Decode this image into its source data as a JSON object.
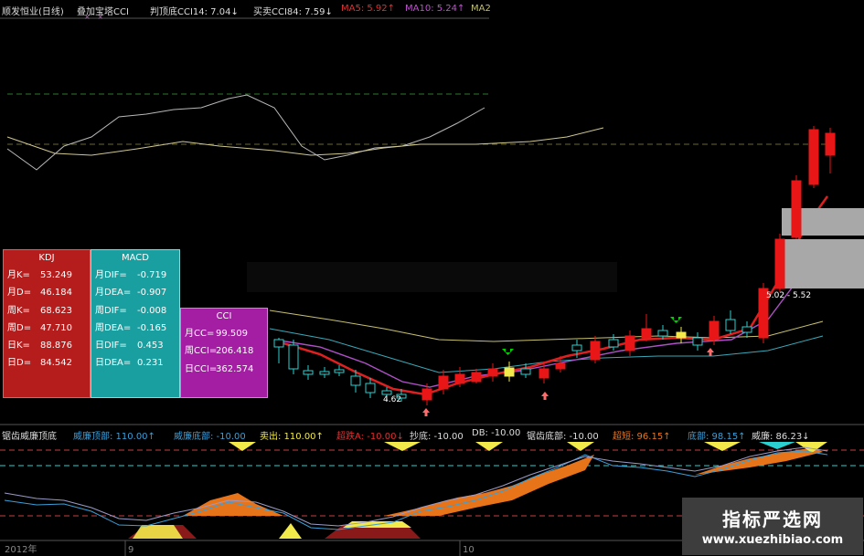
{
  "header": {
    "stock": "顺发恒业(日线)",
    "overlay": "叠加宝塔CCI",
    "ind1": "判顶底CCI14: 7.04↓",
    "ind2": "买卖CCI84: 7.59↓",
    "ma5": "MA5: 5.92↑",
    "ma10": "MA10: 5.24↑",
    "ma20": "MA2"
  },
  "price_labels": {
    "high": "5.02 - 5.52",
    "low": "4.62"
  },
  "kdj": {
    "title": "KDJ",
    "rows": [
      {
        "k": "月K=",
        "v": "53.249"
      },
      {
        "k": "月D=",
        "v": "46.184"
      },
      {
        "k": "周K=",
        "v": "68.623"
      },
      {
        "k": "周D=",
        "v": "47.710"
      },
      {
        "k": "日K=",
        "v": "88.876"
      },
      {
        "k": "日D=",
        "v": "84.542"
      }
    ]
  },
  "macd": {
    "title": "MACD",
    "rows": [
      {
        "k": "月DIF=",
        "v": "-0.719"
      },
      {
        "k": "月DEA=",
        "v": "-0.907"
      },
      {
        "k": "周DIF=",
        "v": "-0.008"
      },
      {
        "k": "周DEA=",
        "v": "-0.165"
      },
      {
        "k": "日DIF=",
        "v": "0.453"
      },
      {
        "k": "日DEA=",
        "v": "0.231"
      }
    ]
  },
  "cci": {
    "title": "CCI",
    "rows": [
      {
        "k": "月CC=",
        "v": "99.509"
      },
      {
        "k": "周CCI=",
        "v": "206.418"
      },
      {
        "k": "日CCI=",
        "v": "362.574"
      }
    ]
  },
  "sub": {
    "title": "锯齿威廉顶底",
    "a": "威廉顶部: 110.00↑",
    "b": "威廉底部: -10.00",
    "c": "卖出: 110.00↑",
    "d": "超跌A: -10.00↓",
    "e": "抄底: -10.00",
    "f": "DB: -10.00",
    "g": "锯齿底部: -10.00",
    "h": "超短: 96.15↑",
    "i": "底部: 98.15↑",
    "j": "威廉: 86.23↓"
  },
  "axis": {
    "year": "2012年",
    "m1": "9",
    "m2": "10"
  },
  "watermark": {
    "title": "指标严选网",
    "url": "www.xuezhibiao.com"
  },
  "colors": {
    "up": "#e81616",
    "down": "#2ad0d0",
    "ma_red": "#e02020",
    "ma_purple": "#b050c8",
    "ma_yellow": "#c8c070",
    "ma_cyan": "#3aa8b8",
    "green_arrow": "#00d000",
    "pink_arrow": "#ff6a6a"
  }
}
